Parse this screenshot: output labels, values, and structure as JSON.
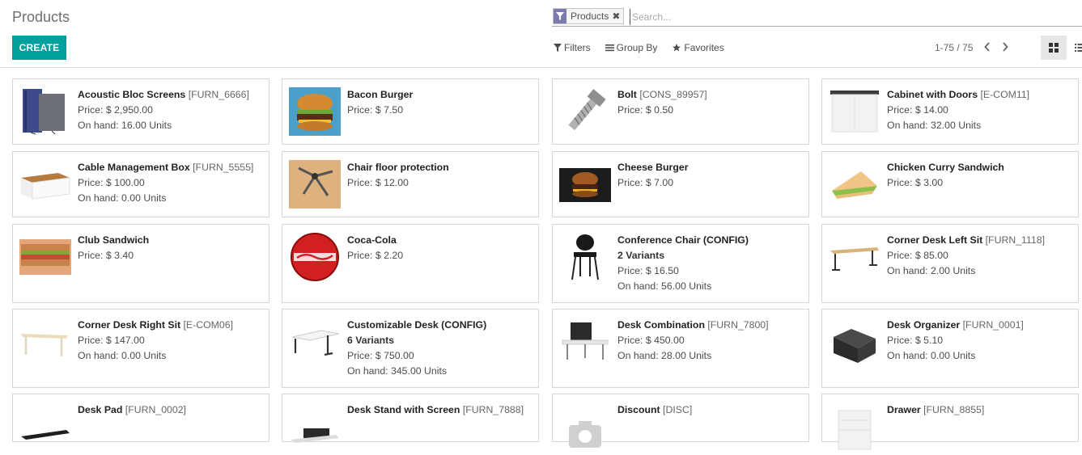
{
  "page": {
    "title": "Products"
  },
  "toolbar": {
    "create_label": "CREATE"
  },
  "search": {
    "facet_label": "Products",
    "facet_close": "✖",
    "placeholder": "Search..."
  },
  "filters": {
    "filters_label": "Filters",
    "groupby_label": "Group By",
    "favorites_label": "Favorites"
  },
  "pager": {
    "value": "1-75 / 75",
    "prev": "‹",
    "next": "›"
  },
  "products": [
    {
      "name": "Acoustic Bloc Screens",
      "code": "[FURN_6666]",
      "variants": "",
      "price": "Price: $ 2,950.00",
      "onhand": "On hand: 16.00 Units",
      "icon": "acoustic-screen-icon"
    },
    {
      "name": "Bacon Burger",
      "code": "",
      "variants": "",
      "price": "Price: $ 7.50",
      "onhand": "",
      "icon": "burger-icon"
    },
    {
      "name": "Bolt",
      "code": "[CONS_89957]",
      "variants": "",
      "price": "Price: $ 0.50",
      "onhand": "",
      "icon": "bolt-icon"
    },
    {
      "name": "Cabinet with Doors",
      "code": "[E-COM11]",
      "variants": "",
      "price": "Price: $ 14.00",
      "onhand": "On hand: 32.00 Units",
      "icon": "cabinet-icon"
    },
    {
      "name": "Cable Management Box",
      "code": "[FURN_5555]",
      "variants": "",
      "price": "Price: $ 100.00",
      "onhand": "On hand: 0.00 Units",
      "icon": "cable-box-icon"
    },
    {
      "name": "Chair floor protection",
      "code": "",
      "variants": "",
      "price": "Price: $ 12.00",
      "onhand": "",
      "icon": "floor-protection-icon"
    },
    {
      "name": "Cheese Burger",
      "code": "",
      "variants": "",
      "price": "Price: $ 7.00",
      "onhand": "",
      "icon": "cheese-burger-icon"
    },
    {
      "name": "Chicken Curry Sandwich",
      "code": "",
      "variants": "",
      "price": "Price: $ 3.00",
      "onhand": "",
      "icon": "sandwich-icon"
    },
    {
      "name": "Club Sandwich",
      "code": "",
      "variants": "",
      "price": "Price: $ 3.40",
      "onhand": "",
      "icon": "club-sandwich-icon"
    },
    {
      "name": "Coca-Cola",
      "code": "",
      "variants": "",
      "price": "Price: $ 2.20",
      "onhand": "",
      "icon": "coca-cola-icon"
    },
    {
      "name": "Conference Chair (CONFIG)",
      "code": "",
      "variants": "2 Variants",
      "price": "Price: $ 16.50",
      "onhand": "On hand: 56.00 Units",
      "icon": "chair-icon"
    },
    {
      "name": "Corner Desk Left Sit",
      "code": "[FURN_1118]",
      "variants": "",
      "price": "Price: $ 85.00",
      "onhand": "On hand: 2.00 Units",
      "icon": "corner-desk-icon"
    },
    {
      "name": "Corner Desk Right Sit",
      "code": "[E-COM06]",
      "variants": "",
      "price": "Price: $ 147.00",
      "onhand": "On hand: 0.00 Units",
      "icon": "corner-desk-right-icon"
    },
    {
      "name": "Customizable Desk (CONFIG)",
      "code": "",
      "variants": "6 Variants",
      "price": "Price: $ 750.00",
      "onhand": "On hand: 345.00 Units",
      "icon": "desk-icon"
    },
    {
      "name": "Desk Combination",
      "code": "[FURN_7800]",
      "variants": "",
      "price": "Price: $ 450.00",
      "onhand": "On hand: 28.00 Units",
      "icon": "desk-combination-icon"
    },
    {
      "name": "Desk Organizer",
      "code": "[FURN_0001]",
      "variants": "",
      "price": "Price: $ 5.10",
      "onhand": "On hand: 0.00 Units",
      "icon": "desk-organizer-icon"
    },
    {
      "name": "Desk Pad",
      "code": "[FURN_0002]",
      "variants": "",
      "price": "",
      "onhand": "",
      "icon": "desk-pad-icon"
    },
    {
      "name": "Desk Stand with Screen",
      "code": "[FURN_7888]",
      "variants": "",
      "price": "",
      "onhand": "",
      "icon": "desk-stand-icon"
    },
    {
      "name": "Discount",
      "code": "[DISC]",
      "variants": "",
      "price": "",
      "onhand": "",
      "icon": "camera-placeholder-icon"
    },
    {
      "name": "Drawer",
      "code": "[FURN_8855]",
      "variants": "",
      "price": "",
      "onhand": "",
      "icon": "drawer-icon"
    }
  ]
}
